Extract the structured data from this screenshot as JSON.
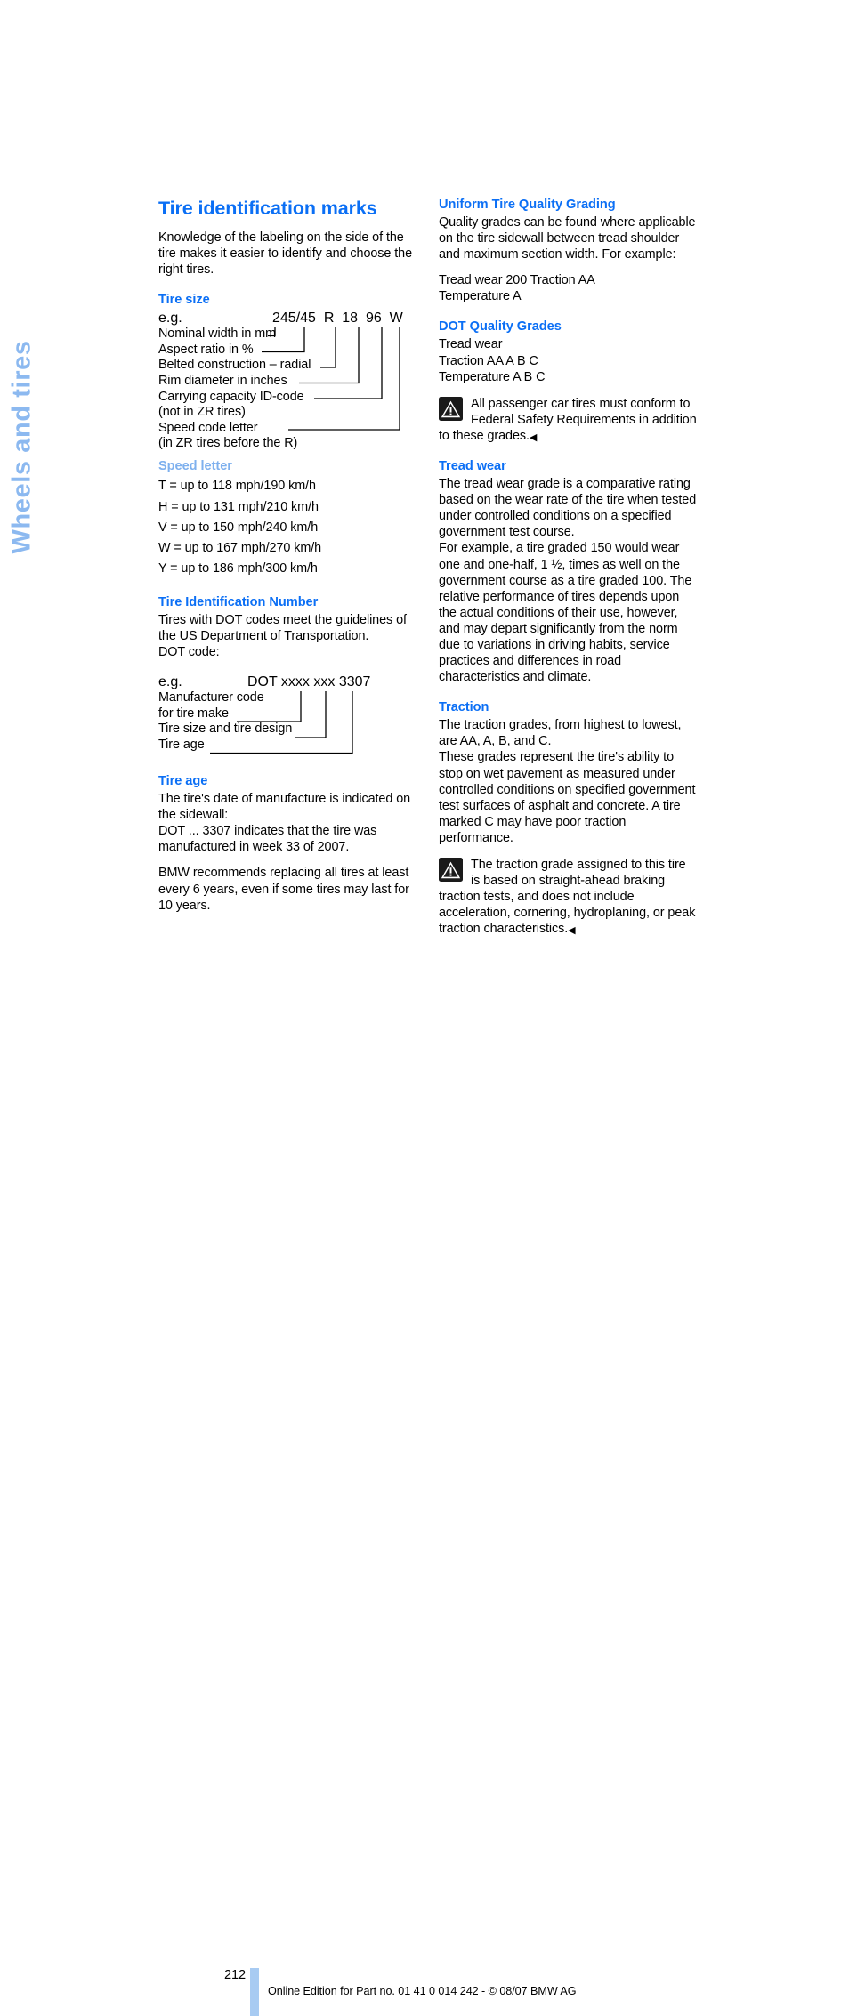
{
  "side_tab": {
    "label": "Wheels and tires",
    "color": "#8cb9f0"
  },
  "page_title": "Tire identification marks",
  "accent_color": "#0b6ff5",
  "left_column": {
    "intro": "Knowledge of the labeling on the side of the tire makes it easier to identify and choose the right tires.",
    "tire_size": {
      "heading": "Tire size",
      "eg_label": "e.g.",
      "code": "245/45  R  18  96  W",
      "callouts": [
        "Nominal width in mm",
        "Aspect ratio in %",
        "Belted construction – radial",
        "Rim diameter in inches",
        "Carrying capacity ID-code",
        "(not in ZR tires)",
        "Speed code letter",
        "(in ZR tires before the R)"
      ]
    },
    "speed_letter": {
      "heading": "Speed letter",
      "entries": [
        "T = up to 118 mph/190 km/h",
        "H = up to 131 mph/210 km/h",
        "V = up to 150 mph/240 km/h",
        "W = up to 167 mph/270 km/h",
        "Y = up to 186 mph/300 km/h"
      ]
    },
    "tin": {
      "heading": "Tire Identification Number",
      "body": "Tires with DOT codes meet the guidelines of the US Department of Transportation.",
      "dot_code_label": "DOT code:",
      "eg_label": "e.g.",
      "code": "DOT xxxx xxx 3307",
      "callouts": [
        "Manufacturer code",
        "for tire make",
        "Tire size and tire design",
        "Tire age"
      ]
    },
    "tire_age": {
      "heading": "Tire age",
      "para1": "The tire's date of manufacture is indicated on the sidewall:",
      "para2": "DOT ... 3307 indicates that the tire was manufactured in week 33 of 2007.",
      "para3": "BMW recommends replacing all tires at least every 6 years, even if some tires may last for 10 years."
    }
  },
  "right_column": {
    "utqg": {
      "heading": "Uniform Tire Quality Grading",
      "para1": "Quality grades can be found where applicable on the tire sidewall between tread shoulder and maximum section width. For example:",
      "para2_line1": "Tread wear 200 Traction AA",
      "para2_line2": "Temperature A"
    },
    "dot_quality_grades": {
      "heading": "DOT Quality Grades",
      "lines": [
        "Tread wear",
        "Traction AA A B C",
        "Temperature A B C"
      ],
      "note": "All passenger car tires must conform to Federal Safety Requirements in addition to these grades.",
      "note_end_mark": "◀"
    },
    "tread_wear": {
      "heading": "Tread wear",
      "para1": "The tread wear grade is a comparative rating based on the wear rate of the tire when tested under controlled conditions on a specified government test course.",
      "para2": "For example, a tire graded 150 would wear one and one-half, 1 ½, times as well on the government course as a tire graded 100. The relative performance of tires depends upon the actual conditions of their use, however, and may depart significantly from the norm due to variations in driving habits, service practices and differences in road characteristics and climate."
    },
    "traction": {
      "heading": "Traction",
      "para1": "The traction grades, from highest to lowest, are AA, A, B, and C.",
      "para2": "These grades represent the tire's ability to stop on wet pavement as measured under controlled conditions on specified government test surfaces of asphalt and concrete. A tire marked C may have poor traction performance.",
      "note": "The traction grade assigned to this tire is based on straight-ahead braking traction tests, and does not include acceleration, cornering, hydroplaning, or peak traction characteristics.",
      "note_end_mark": "◀"
    }
  },
  "footer": {
    "page_number": "212",
    "text": "Online Edition for Part no. 01 41 0 014 242 - © 08/07 BMW AG",
    "bar_color": "#a8cbf2"
  }
}
